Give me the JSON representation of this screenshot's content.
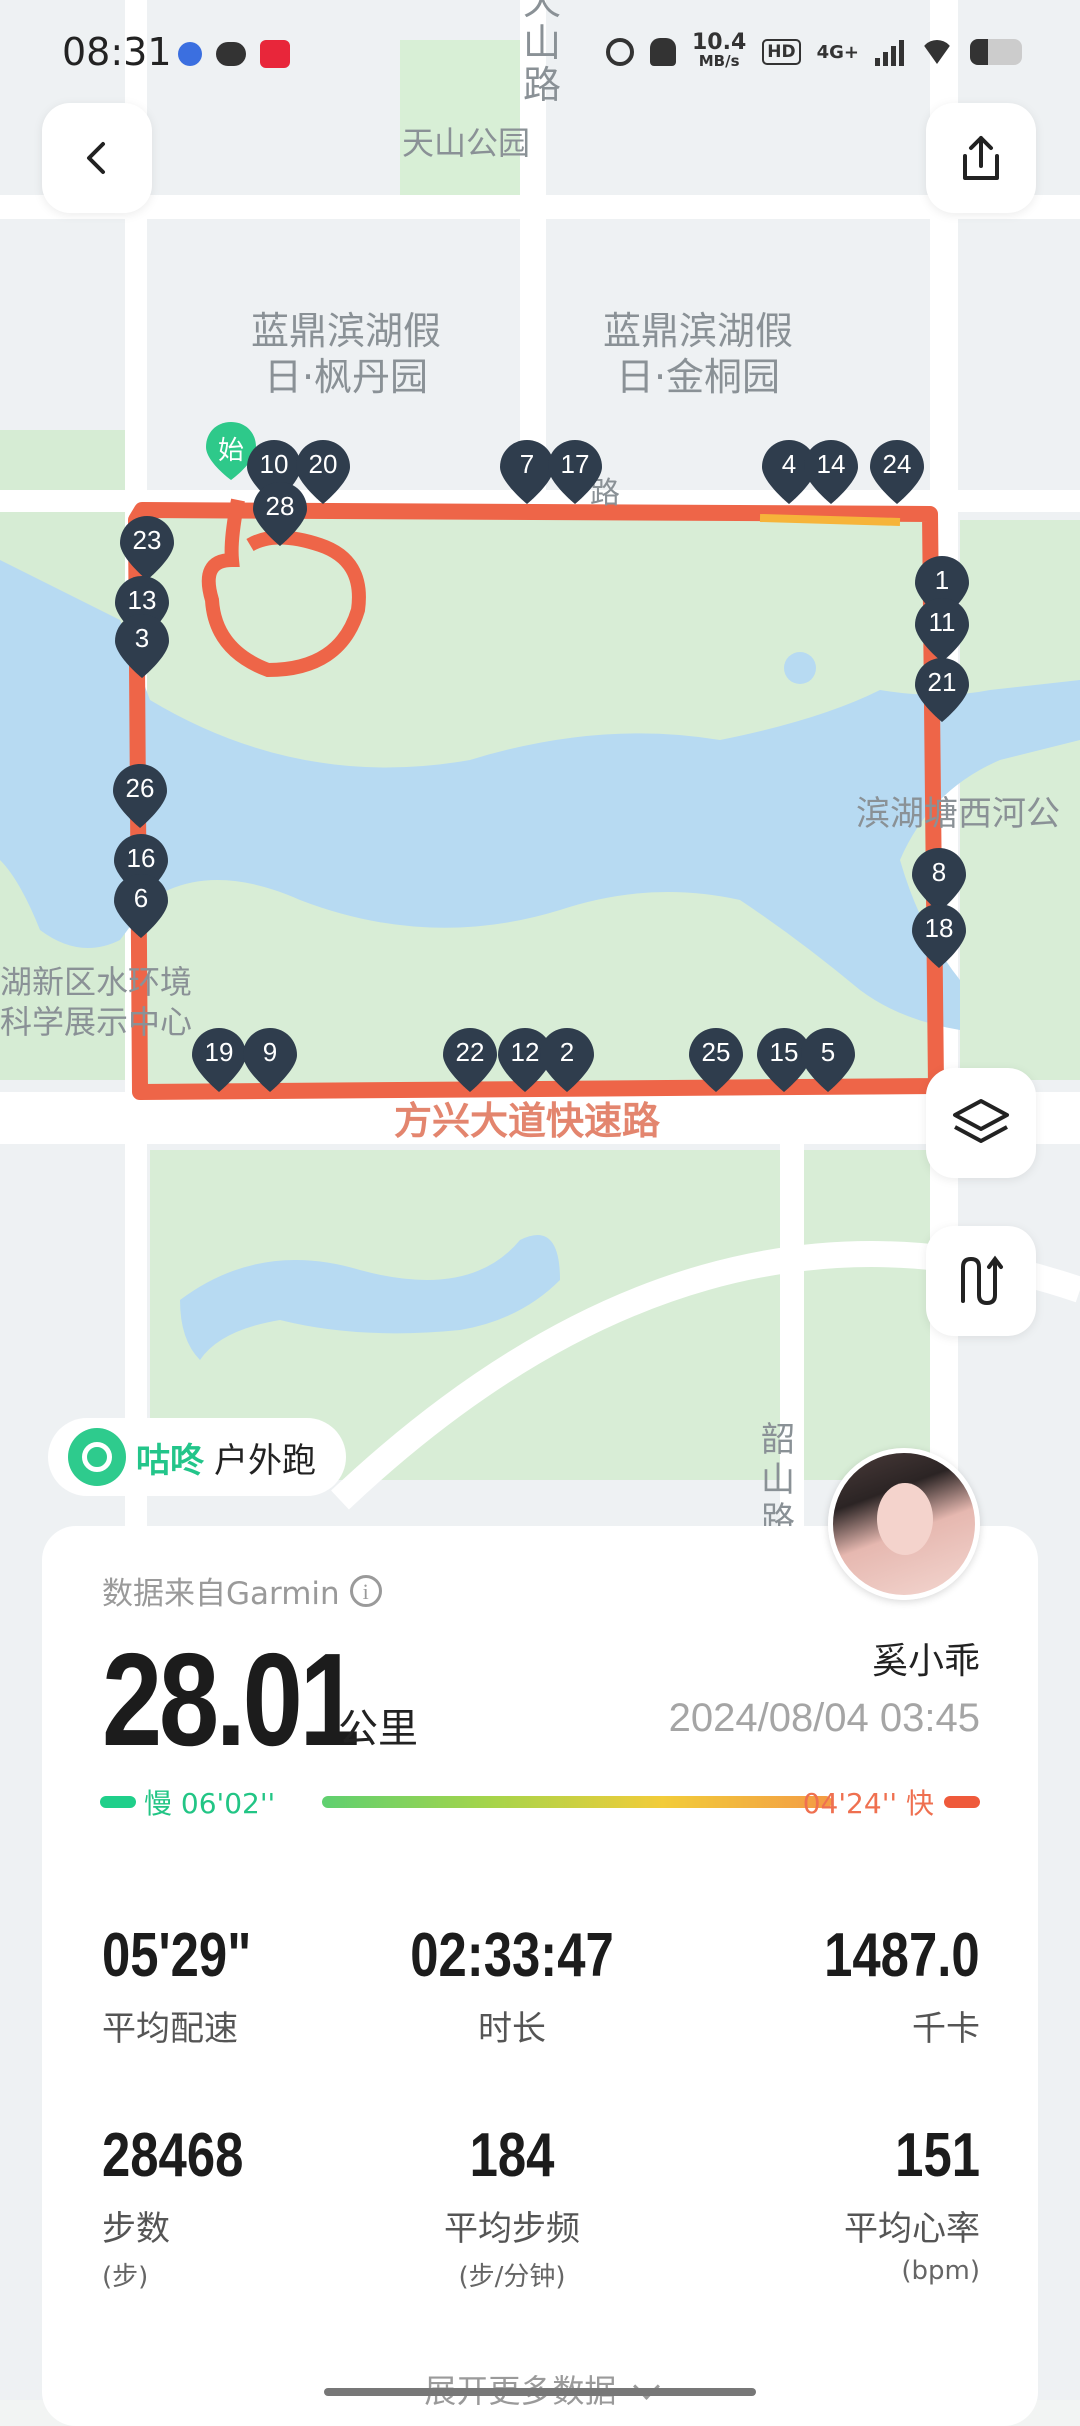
{
  "status_bar": {
    "time": "08:31",
    "left_icons": [
      "baidu-icon",
      "wechat-icon",
      "xiaohongshu-icon"
    ],
    "net_speed_value": "10.4",
    "net_speed_unit": "MB/s",
    "hd": "HD",
    "network": "4G+",
    "right_icons": [
      "alarm-icon",
      "mute-icon",
      "signal-icon",
      "wifi-icon",
      "battery-icon"
    ]
  },
  "map": {
    "labels": {
      "tianshan_road": "天山路",
      "tianshan_park": "天山公园",
      "landing_fengdan_1": "蓝鼎滨湖假",
      "landing_fengdan_2": "日·枫丹园",
      "landing_jintong_1": "蓝鼎滨湖假",
      "landing_jintong_2": "日·金桐园",
      "north_road": "路",
      "binhu_river": "滨湖塘西河公",
      "science_1": "湖新区水环境",
      "science_2": "科学展示中心",
      "fangxing_road": "方兴大道快速路",
      "shaoshan_road": "韶山路"
    },
    "start_marker": "始",
    "km_markers": [
      {
        "n": "10"
      },
      {
        "n": "20"
      },
      {
        "n": "28"
      },
      {
        "n": "7"
      },
      {
        "n": "17"
      },
      {
        "n": "4"
      },
      {
        "n": "14"
      },
      {
        "n": "24"
      },
      {
        "n": "23"
      },
      {
        "n": "13"
      },
      {
        "n": "3"
      },
      {
        "n": "26"
      },
      {
        "n": "16"
      },
      {
        "n": "6"
      },
      {
        "n": "1"
      },
      {
        "n": "11"
      },
      {
        "n": "21"
      },
      {
        "n": "8"
      },
      {
        "n": "18"
      },
      {
        "n": "19"
      },
      {
        "n": "9"
      },
      {
        "n": "22"
      },
      {
        "n": "12"
      },
      {
        "n": "2"
      },
      {
        "n": "25"
      },
      {
        "n": "15"
      },
      {
        "n": "5"
      }
    ],
    "route_color": "#ee6548"
  },
  "app_tag": {
    "brand": "咕咚",
    "activity": "户外跑"
  },
  "summary": {
    "source": "数据来自Garmin",
    "distance": "28.01",
    "distance_unit": "公里",
    "username": "奚小乖",
    "datetime": "2024/08/04 03:45",
    "pace_slow_label": "慢 06'02''",
    "pace_fast_label": "04'24'' 快"
  },
  "stats": [
    {
      "value": "05'29\"",
      "label": "平均配速",
      "unit": ""
    },
    {
      "value": "02:33:47",
      "label": "时长",
      "unit": ""
    },
    {
      "value": "1487.0",
      "label": "千卡",
      "unit": ""
    },
    {
      "value": "28468",
      "label": "步数",
      "unit": "(步)"
    },
    {
      "value": "184",
      "label": "平均步频",
      "unit": "(步/分钟)"
    },
    {
      "value": "151",
      "label": "平均心率",
      "unit": "(bpm)"
    }
  ],
  "expand_label": "展开更多数据",
  "colors": {
    "accent_green": "#23c58a",
    "route_red": "#ee6548",
    "pin_dark": "#2f3d4d"
  }
}
